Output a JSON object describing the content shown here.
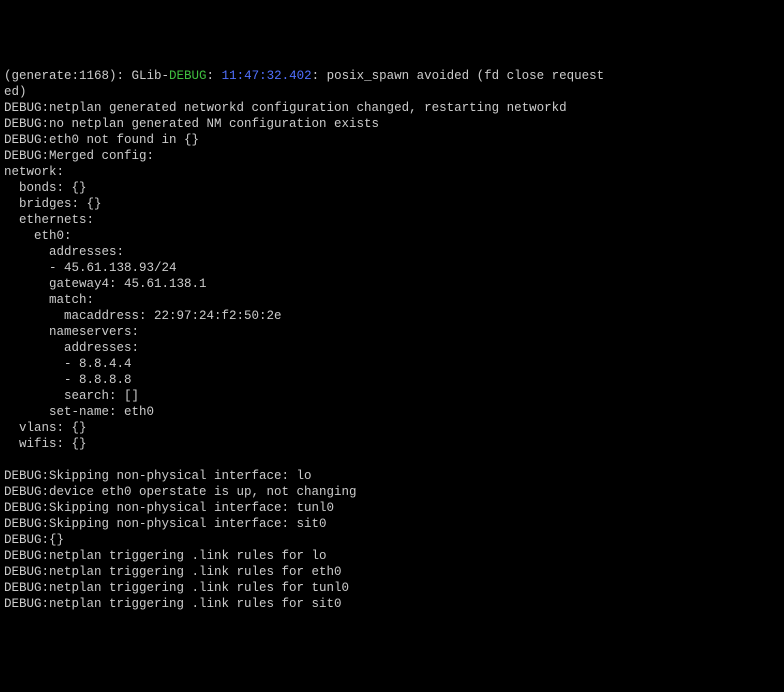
{
  "line1_prefix": "(generate:1168): GLib-",
  "line1_debug": "DEBUG",
  "line1_sep": ": ",
  "line1_time": "11:47:32.402",
  "line1_rest": ": posix_spawn avoided (fd close request",
  "line2": "ed)",
  "line3": "DEBUG:netplan generated networkd configuration changed, restarting networkd",
  "line4": "DEBUG:no netplan generated NM configuration exists",
  "line5": "DEBUG:eth0 not found in {}",
  "line6": "DEBUG:Merged config:",
  "line7": "network:",
  "line8": "  bonds: {}",
  "line9": "  bridges: {}",
  "line10": "  ethernets:",
  "line11": "    eth0:",
  "line12": "      addresses:",
  "line13": "      - 45.61.138.93/24",
  "line14": "      gateway4: 45.61.138.1",
  "line15": "      match:",
  "line16": "        macaddress: 22:97:24:f2:50:2e",
  "line17": "      nameservers:",
  "line18": "        addresses:",
  "line19": "        - 8.8.4.4",
  "line20": "        - 8.8.8.8",
  "line21": "        search: []",
  "line22": "      set-name: eth0",
  "line23": "  vlans: {}",
  "line24": "  wifis: {}",
  "line25": "",
  "line26": "DEBUG:Skipping non-physical interface: lo",
  "line27": "DEBUG:device eth0 operstate is up, not changing",
  "line28": "DEBUG:Skipping non-physical interface: tunl0",
  "line29": "DEBUG:Skipping non-physical interface: sit0",
  "line30": "DEBUG:{}",
  "line31": "DEBUG:netplan triggering .link rules for lo",
  "line32": "DEBUG:netplan triggering .link rules for eth0",
  "line33": "DEBUG:netplan triggering .link rules for tunl0",
  "line34": "DEBUG:netplan triggering .link rules for sit0"
}
